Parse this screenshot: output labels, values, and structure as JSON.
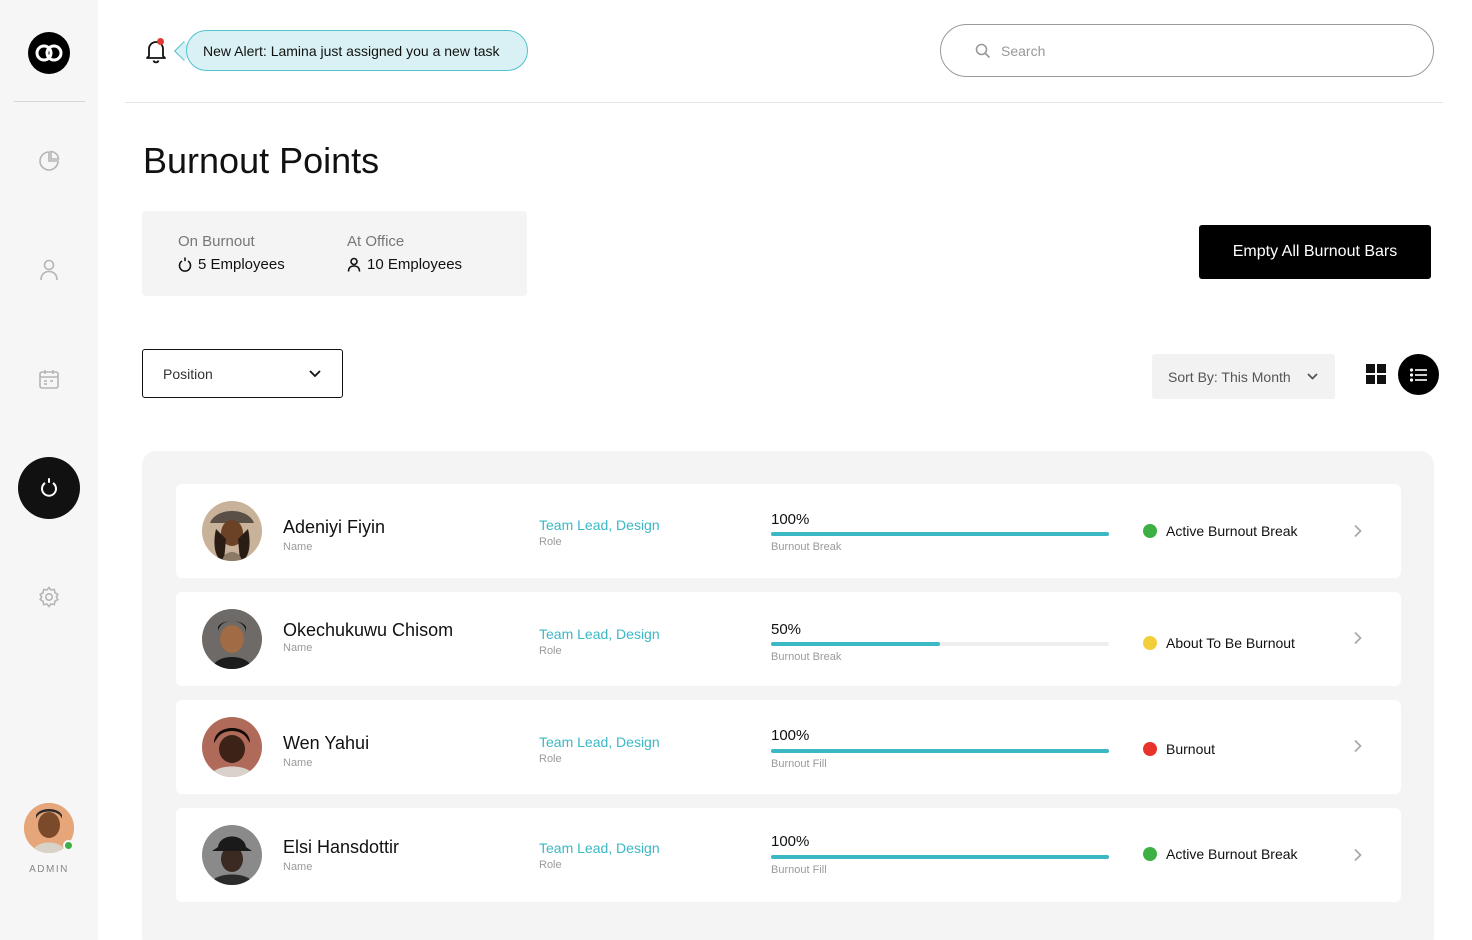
{
  "sidebar": {
    "admin_label": "ADMIN",
    "active_item": "burnout",
    "items": [
      {
        "name": "analytics-icon"
      },
      {
        "name": "user-icon"
      },
      {
        "name": "calendar-icon"
      },
      {
        "name": "burnout-icon"
      },
      {
        "name": "settings-icon"
      }
    ]
  },
  "header": {
    "alert_text": "New Alert: Lamina just assigned you a new task",
    "search_placeholder": "Search"
  },
  "page": {
    "title": "Burnout Points"
  },
  "stats": {
    "on_burnout_label": "On Burnout",
    "on_burnout_value": "5 Employees",
    "at_office_label": "At Office",
    "at_office_value": "10 Employees"
  },
  "actions": {
    "empty_button": "Empty All Burnout Bars"
  },
  "filters": {
    "position_label": "Position",
    "sort_label": "Sort By: This Month"
  },
  "colors": {
    "accent": "#3ab8c4",
    "green": "#3cb043",
    "yellow": "#f2cf3a",
    "red": "#e8332a"
  },
  "employees": [
    {
      "name": "Adeniyi Fiyin",
      "name_caption": "Name",
      "role": "Team Lead, Design",
      "role_caption": "Role",
      "percent_label": "100%",
      "percent": 100,
      "bar_caption": "Burnout Break",
      "status": "Active Burnout Break",
      "status_color": "#3cb043"
    },
    {
      "name": "Okechukuwu Chisom",
      "name_caption": "Name",
      "role": "Team Lead, Design",
      "role_caption": "Role",
      "percent_label": "50%",
      "percent": 50,
      "bar_caption": "Burnout Break",
      "status": "About To Be Burnout",
      "status_color": "#f2cf3a"
    },
    {
      "name": "Wen Yahui",
      "name_caption": "Name",
      "role": "Team Lead, Design",
      "role_caption": "Role",
      "percent_label": "100%",
      "percent": 100,
      "bar_caption": "Burnout Fill",
      "status": "Burnout",
      "status_color": "#e8332a"
    },
    {
      "name": "Elsi Hansdottir",
      "name_caption": "Name",
      "role": "Team Lead, Design",
      "role_caption": "Role",
      "percent_label": "100%",
      "percent": 100,
      "bar_caption": "Burnout Fill",
      "status": "Active Burnout Break",
      "status_color": "#3cb043"
    }
  ]
}
